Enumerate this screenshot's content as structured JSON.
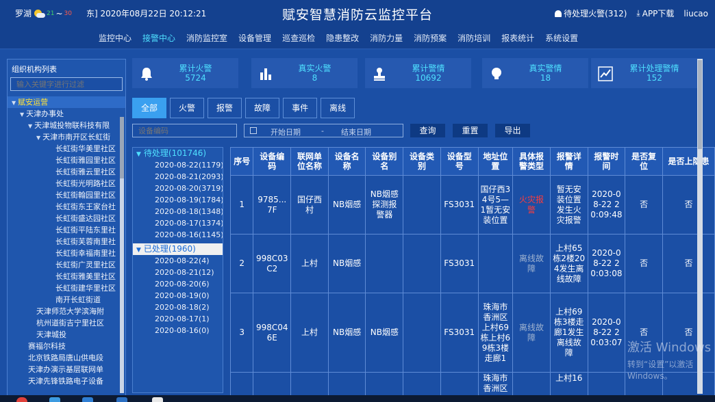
{
  "header": {
    "location": "罗湖",
    "temp_low": "21",
    "temp_sep": "~",
    "temp_high": "30",
    "datetime": "东] 2020年08月22日 20:12:21",
    "title": "赋安智慧消防云监控平台",
    "pending_alarm": "待处理火警(312)",
    "app_download": "APP下载",
    "user": "liucao"
  },
  "nav": {
    "tabs": [
      "监控中心",
      "接警中心",
      "消防监控室",
      "设备管理",
      "巡查巡检",
      "隐患整改",
      "消防力量",
      "消防预案",
      "消防培训",
      "报表统计",
      "系统设置"
    ],
    "active": "接警中心"
  },
  "sidebar": {
    "title": "组织机构列表",
    "filter_placeholder": "输入关键字进行过滤",
    "tree": [
      {
        "label": "赋安运营",
        "level": 0,
        "arrow": "▼",
        "selected": true
      },
      {
        "label": "天津办事处",
        "level": 1,
        "arrow": "▼"
      },
      {
        "label": "天津城投物联科技有限",
        "level": 2,
        "arrow": "▼"
      },
      {
        "label": "天津市南开区长虹街",
        "level": 3,
        "arrow": "▼"
      },
      {
        "label": "长虹街华美里社区",
        "level": 4,
        "arrow": ""
      },
      {
        "label": "长虹街雅园里社区",
        "level": 4,
        "arrow": ""
      },
      {
        "label": "长虹街雅云里社区",
        "level": 4,
        "arrow": ""
      },
      {
        "label": "长虹街光明路社区",
        "level": 4,
        "arrow": ""
      },
      {
        "label": "长虹街翰园里社区",
        "level": 4,
        "arrow": ""
      },
      {
        "label": "长虹街东王家台社",
        "level": 4,
        "arrow": ""
      },
      {
        "label": "长虹街盛达园社区",
        "level": 4,
        "arrow": ""
      },
      {
        "label": "长虹街平陆东里社",
        "level": 4,
        "arrow": ""
      },
      {
        "label": "长虹街芙蓉南里社",
        "level": 4,
        "arrow": ""
      },
      {
        "label": "长虹街幸福南里社",
        "level": 4,
        "arrow": ""
      },
      {
        "label": "长虹街广灵里社区",
        "level": 4,
        "arrow": ""
      },
      {
        "label": "长虹街雅美里社区",
        "level": 4,
        "arrow": ""
      },
      {
        "label": "长虹街建华里社区",
        "level": 4,
        "arrow": ""
      },
      {
        "label": "南开长虹街道",
        "level": 4,
        "arrow": ""
      },
      {
        "label": "天津师范大学滨海附",
        "level": 3,
        "arrow": ""
      },
      {
        "label": "杭州道街吉宁里社区",
        "level": 3,
        "arrow": ""
      },
      {
        "label": "天津城投",
        "level": 3,
        "arrow": ""
      },
      {
        "label": "赛福尔科技",
        "level": 2,
        "arrow": ""
      },
      {
        "label": "北京铁路局唐山供电段",
        "level": 2,
        "arrow": ""
      },
      {
        "label": "天津办演示基层联网单",
        "level": 2,
        "arrow": ""
      },
      {
        "label": "天津先锋铁路电子设备",
        "level": 2,
        "arrow": ""
      }
    ]
  },
  "stats": [
    {
      "label": "累计火警",
      "value": "5724",
      "icon": "bell-icon"
    },
    {
      "label": "真实火警",
      "value": "8",
      "icon": "bar-chart-icon"
    },
    {
      "label": "累计警情",
      "value": "10692",
      "icon": "stamp-icon"
    },
    {
      "label": "真实警情",
      "value": "18",
      "icon": "lightbulb-icon"
    },
    {
      "label": "累计处理警情",
      "value": "152",
      "icon": "line-chart-icon"
    }
  ],
  "filter_tabs": [
    "全部",
    "火警",
    "报警",
    "故障",
    "事件",
    "离线"
  ],
  "search": {
    "device_code_placeholder": "设备编码",
    "start_date_placeholder": "开始日期",
    "date_sep": "-",
    "end_date_placeholder": "结束日期",
    "query_label": "查询",
    "reset_label": "重置",
    "export_label": "导出"
  },
  "status_groups": [
    {
      "label": "待处理(101746)",
      "arrow": "▼",
      "dates": [
        "2020-08-22(1179)",
        "2020-08-21(2093)",
        "2020-08-20(3719)",
        "2020-08-19(1784)",
        "2020-08-18(1348)",
        "2020-08-17(1374)",
        "2020-08-16(1145)"
      ]
    },
    {
      "label": "已处理(1960)",
      "arrow": "▼",
      "dates": [
        "2020-08-22(4)",
        "2020-08-21(12)",
        "2020-08-20(6)",
        "2020-08-19(0)",
        "2020-08-18(2)",
        "2020-08-17(1)",
        "2020-08-16(0)"
      ]
    }
  ],
  "table": {
    "columns": [
      "序号",
      "设备编码",
      "联网单位名称",
      "设备名称",
      "设备别名",
      "设备类别",
      "设备型号",
      "地址位置",
      "具体报警类型",
      "报警详情",
      "报警时间",
      "是否复位",
      "是否上隐患"
    ],
    "rows": [
      [
        "1",
        "9785...7F",
        "国仔西村",
        "NB烟感",
        "NB烟感探测报警器",
        "",
        "FS3031",
        "国仔西34号5—1暂无安装位置",
        "火灾报警",
        "暂无安装位置发生火灾报警",
        "2020-08-22 20:09:48",
        "否",
        "否"
      ],
      [
        "2",
        "998C03C2",
        "上村",
        "NB烟感",
        "",
        "",
        "FS3031",
        "",
        "离线故障",
        "上村65栋2楼204发生离线故障",
        "2020-08-22 20:03:08",
        "否",
        "否"
      ],
      [
        "3",
        "998C046E",
        "上村",
        "NB烟感",
        "NB烟感",
        "",
        "FS3031",
        "珠海市香洲区上村69栋上村69栋3楼走廊1",
        "离线故障",
        "上村69栋3楼走廊1发生离线故障",
        "2020-08-22 20:03:07",
        "否",
        "否"
      ],
      [
        "",
        "",
        "",
        "",
        "",
        "",
        "",
        "珠海市香洲区",
        "",
        "上村16",
        "",
        "",
        ""
      ]
    ]
  },
  "watermark": {
    "line1": "激活 Windows",
    "line2": "转到“设置”以激活 Windows。"
  }
}
